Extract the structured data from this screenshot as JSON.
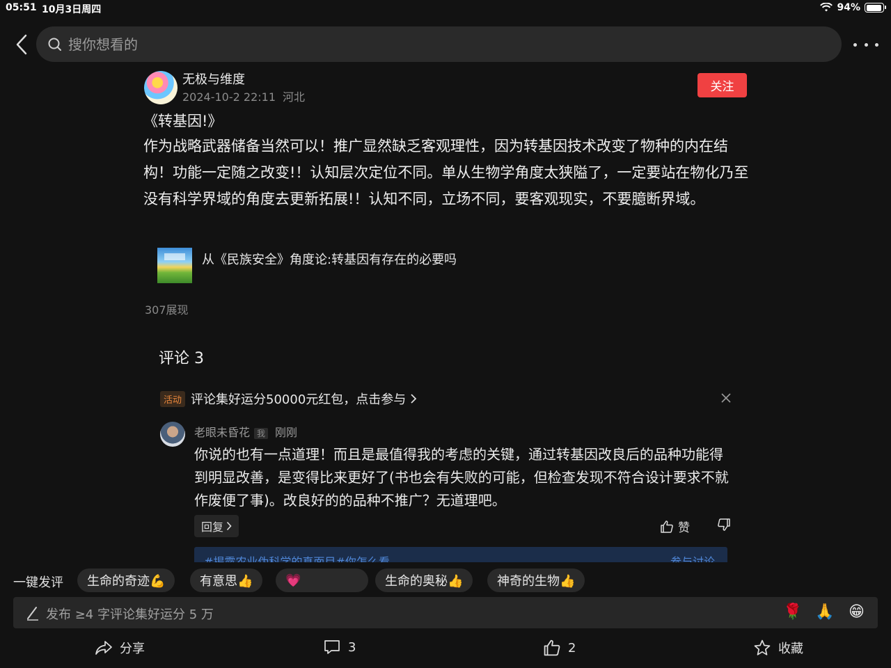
{
  "status_bar": {
    "time": "05:51",
    "date": "10月3日周四",
    "battery": "94%"
  },
  "search": {
    "placeholder": "搜你想看的"
  },
  "post": {
    "author": "无极与维度",
    "datetime": "2024-10-2 22:11",
    "location": "河北",
    "follow_label": "关注",
    "title": "《转基因!》",
    "body": "作为战略武器储备当然可以！推广显然缺乏客观理性，因为转基因技术改变了物种的内在结构！功能一定随之改变!！认知层次定位不同。单从生物学角度太狭隘了，一定要站在物化乃至没有科学界域的角度去更新拓展!！认知不同，立场不同，要客观现实，不要臆断界域。",
    "linked_article": "从《民族安全》角度论:转基因有存在的必要吗",
    "views": "307展现"
  },
  "comments": {
    "header": "评论 3",
    "activity_tag": "活动",
    "activity_text": "评论集好运分50000元红包，点击参与",
    "items": [
      {
        "author": "老眼未昏花",
        "me_tag": "我",
        "time": "刚刚",
        "text": "你说的也有一点道理！而且是最值得我的考虑的关键，通过转基因改良后的品种功能得到明显改善，是变得比来更好了(书也会有失败的可能，但检查发现不符合设计要求不就作废便了事)。改良好的的品种不推广？无道理吧。",
        "reply_label": "回复",
        "like_label": "赞"
      }
    ],
    "topic_text": "#揭露农业伪科学的真面目#你怎么看",
    "topic_join": "参与讨论"
  },
  "quick_replies": {
    "label": "一键发评",
    "chips": [
      "生命的奇迹💪",
      "有意思👍",
      "💗",
      "生命的奥秘👍",
      "神奇的生物👍"
    ]
  },
  "compose": {
    "placeholder": "发布 ≥4 字评论集好运分 5 万",
    "emojis": [
      "🌹",
      "🙏",
      "😁"
    ]
  },
  "actions": {
    "share": "分享",
    "comments": "3",
    "likes": "2",
    "favorite": "收藏"
  },
  "colors": {
    "background": "#121212",
    "follow_button": "#f04142",
    "activity_tag": "#e8863b",
    "topic_link": "#4f86d6"
  }
}
